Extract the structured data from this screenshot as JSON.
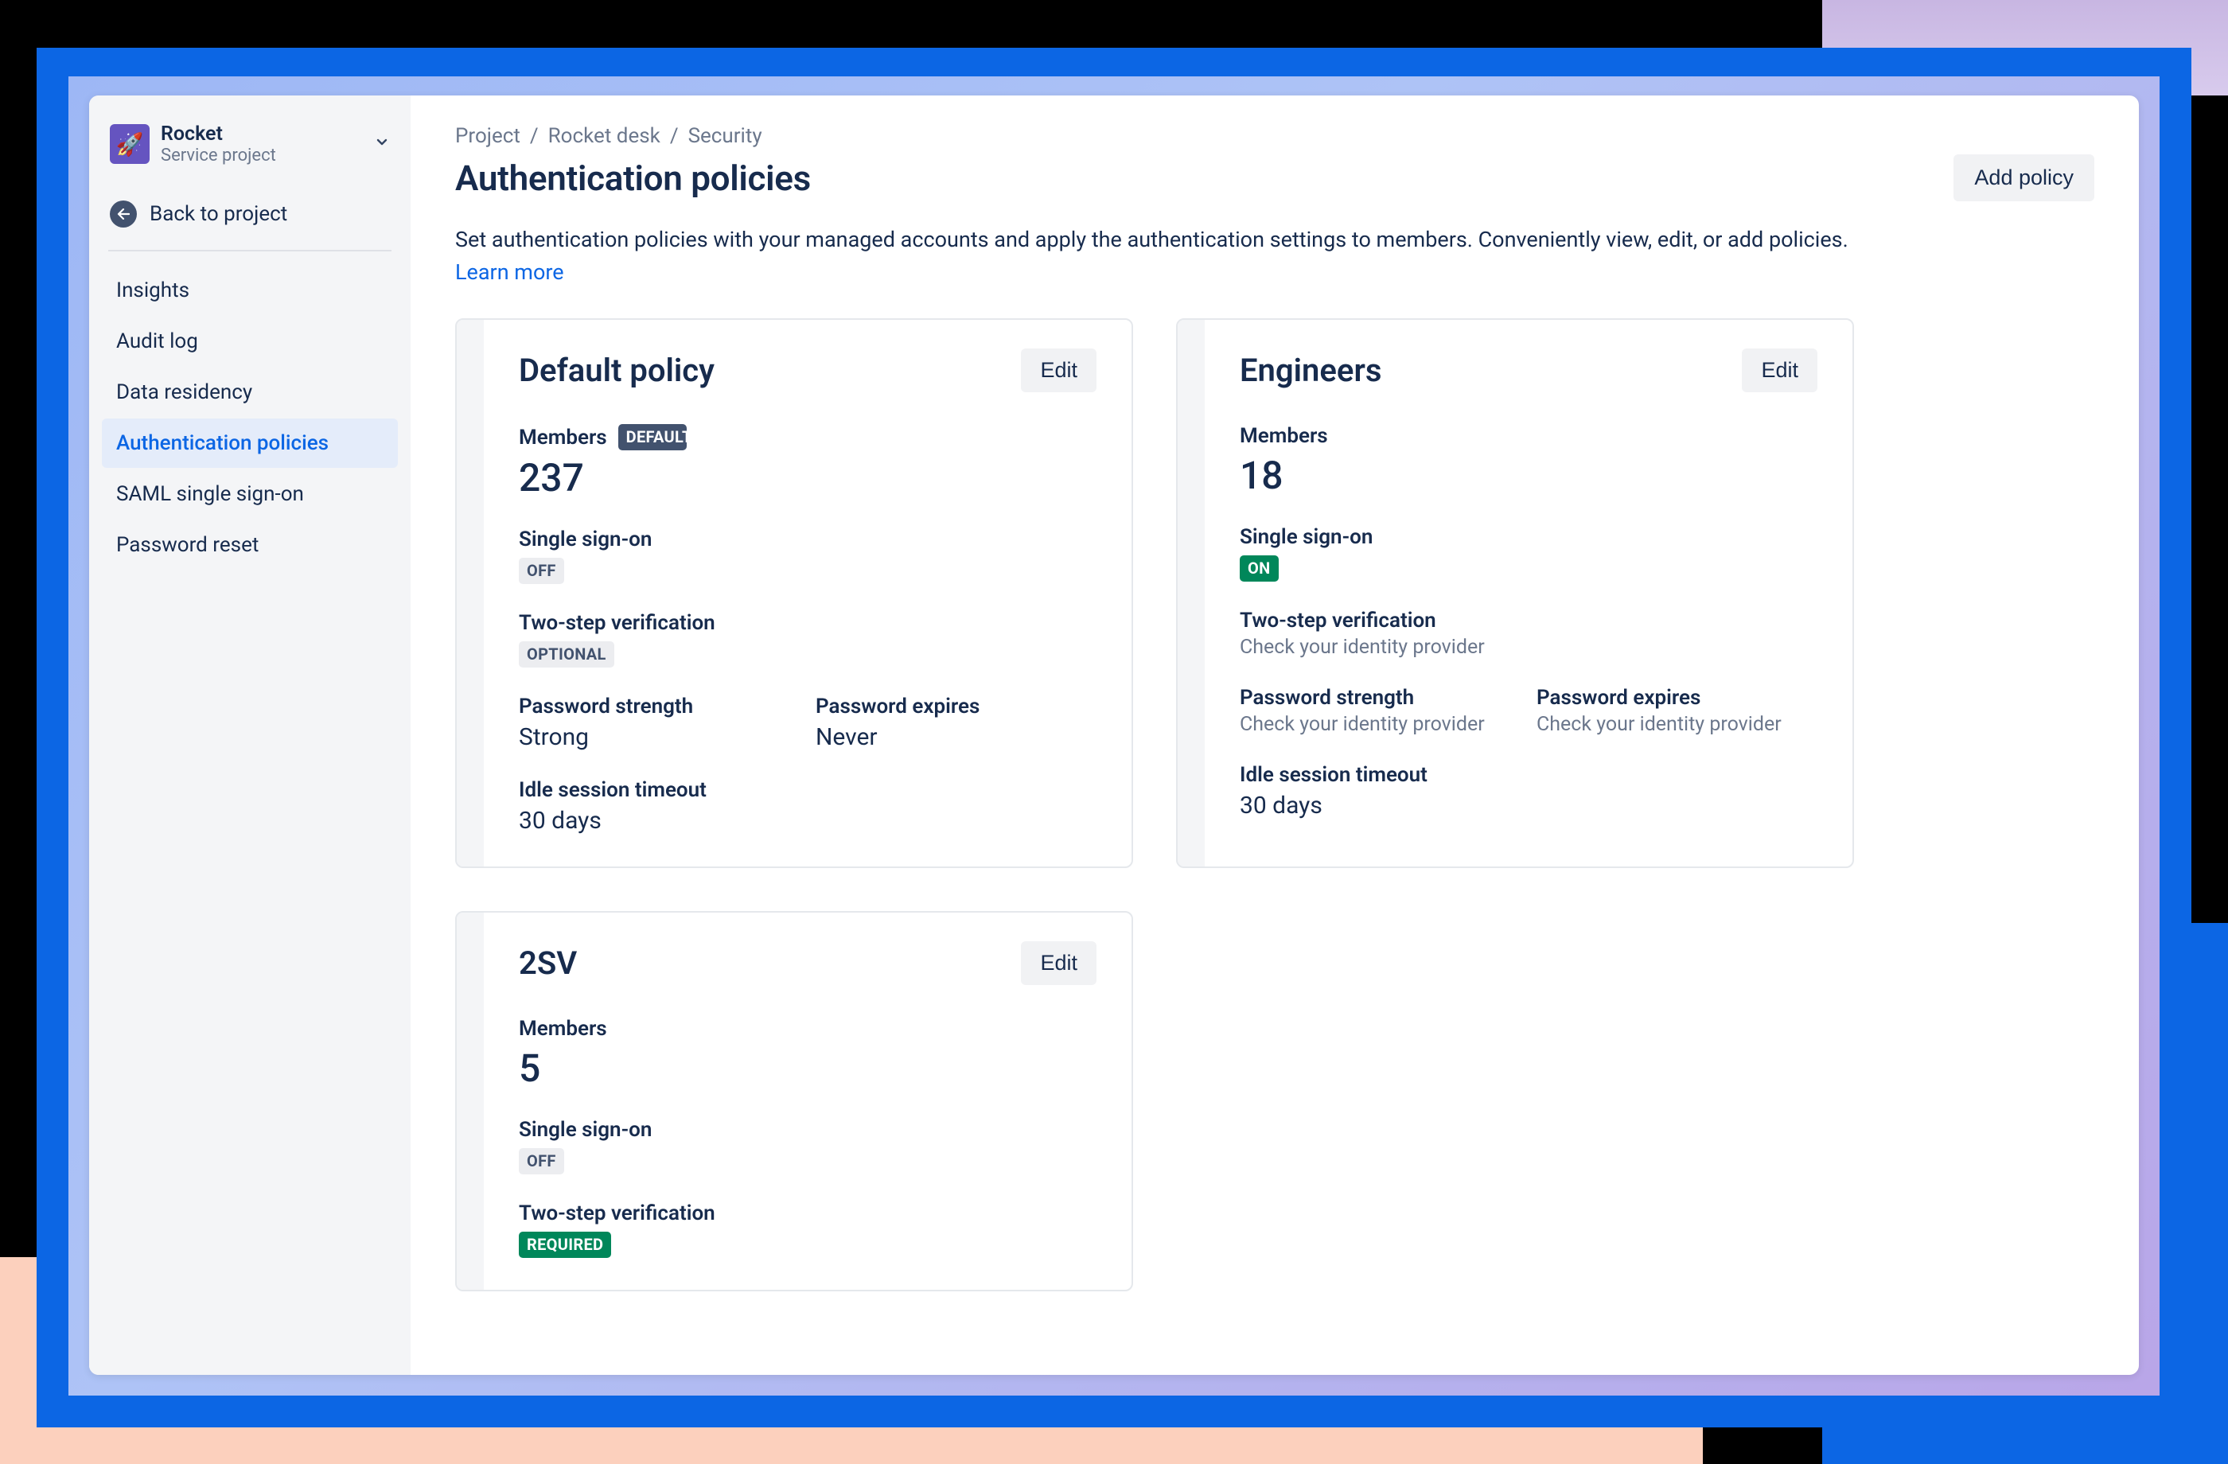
{
  "sidebar": {
    "project_name": "Rocket",
    "project_type": "Service project",
    "back_label": "Back to project",
    "items": [
      {
        "label": "Insights",
        "active": false
      },
      {
        "label": "Audit log",
        "active": false
      },
      {
        "label": "Data residency",
        "active": false
      },
      {
        "label": "Authentication policies",
        "active": true
      },
      {
        "label": "SAML single sign-on",
        "active": false
      },
      {
        "label": "Password reset",
        "active": false
      }
    ]
  },
  "breadcrumbs": [
    "Project",
    "Rocket desk",
    "Security"
  ],
  "page": {
    "title": "Authentication policies",
    "add_button": "Add policy",
    "description": "Set authentication policies with your managed accounts and apply the authentication settings to members. Conveniently view, edit, or add policies. ",
    "learn_more": "Learn more"
  },
  "labels": {
    "members": "Members",
    "sso": "Single sign-on",
    "two_step": "Two-step verification",
    "pwd_strength": "Password strength",
    "pwd_expires": "Password expires",
    "idle": "Idle session timeout",
    "edit": "Edit",
    "default_badge": "DEFAULT"
  },
  "policies": [
    {
      "name": "Default policy",
      "default": true,
      "members": "237",
      "sso_badge": "OFF",
      "sso_style": "off",
      "two_step_badge": "OPTIONAL",
      "two_step_style": "optional",
      "two_step_helper": null,
      "pwd_strength": "Strong",
      "pwd_strength_helper": null,
      "pwd_expires": "Never",
      "pwd_expires_helper": null,
      "idle": "30 days"
    },
    {
      "name": "Engineers",
      "default": false,
      "members": "18",
      "sso_badge": "ON",
      "sso_style": "on",
      "two_step_badge": null,
      "two_step_helper": "Check your identity provider",
      "pwd_strength": null,
      "pwd_strength_helper": "Check your identity provider",
      "pwd_expires": null,
      "pwd_expires_helper": "Check your identity provider",
      "idle": "30 days"
    },
    {
      "name": "2SV",
      "default": false,
      "members": "5",
      "sso_badge": "OFF",
      "sso_style": "off",
      "two_step_badge": "REQUIRED",
      "two_step_style": "required",
      "two_step_helper": null,
      "pwd_strength": null,
      "pwd_strength_helper": null,
      "pwd_expires": null,
      "pwd_expires_helper": null,
      "idle": null
    }
  ]
}
